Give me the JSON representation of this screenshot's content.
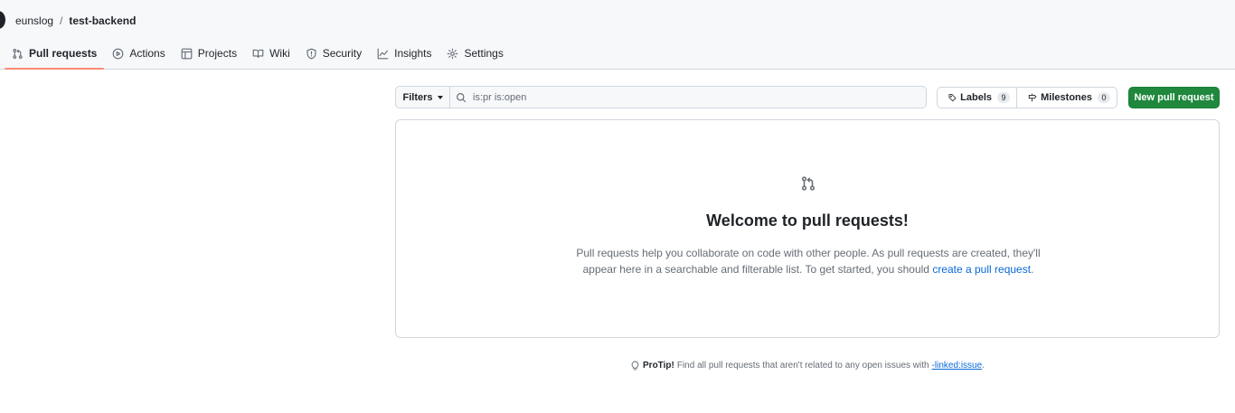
{
  "repo": {
    "owner": "eunslog",
    "separator": "/",
    "name": "test-backend"
  },
  "tabs": [
    {
      "label": "Pull requests",
      "icon": "git-pull-request-icon",
      "selected": true
    },
    {
      "label": "Actions",
      "icon": "play-icon"
    },
    {
      "label": "Projects",
      "icon": "table-icon"
    },
    {
      "label": "Wiki",
      "icon": "book-icon"
    },
    {
      "label": "Security",
      "icon": "shield-icon"
    },
    {
      "label": "Insights",
      "icon": "graph-icon"
    },
    {
      "label": "Settings",
      "icon": "gear-icon"
    }
  ],
  "toolbar": {
    "filters_label": "Filters",
    "search_value": "is:pr is:open",
    "labels_label": "Labels",
    "labels_count": "9",
    "milestones_label": "Milestones",
    "milestones_count": "0",
    "new_pr_label": "New pull request"
  },
  "blankslate": {
    "title": "Welcome to pull requests!",
    "text": "Pull requests help you collaborate on code with other people. As pull requests are created, they'll appear here in a searchable and filterable list. To get started, you should ",
    "link": "create a pull request",
    "end": "."
  },
  "protip": {
    "label": "ProTip!",
    "text": "Find all pull requests that aren't related to any open issues with",
    "link": "-linked:issue",
    "end": "."
  },
  "colors": {
    "primary_button": "#1f883d",
    "link": "#0969da",
    "tab_underline": "#fd8c73"
  }
}
